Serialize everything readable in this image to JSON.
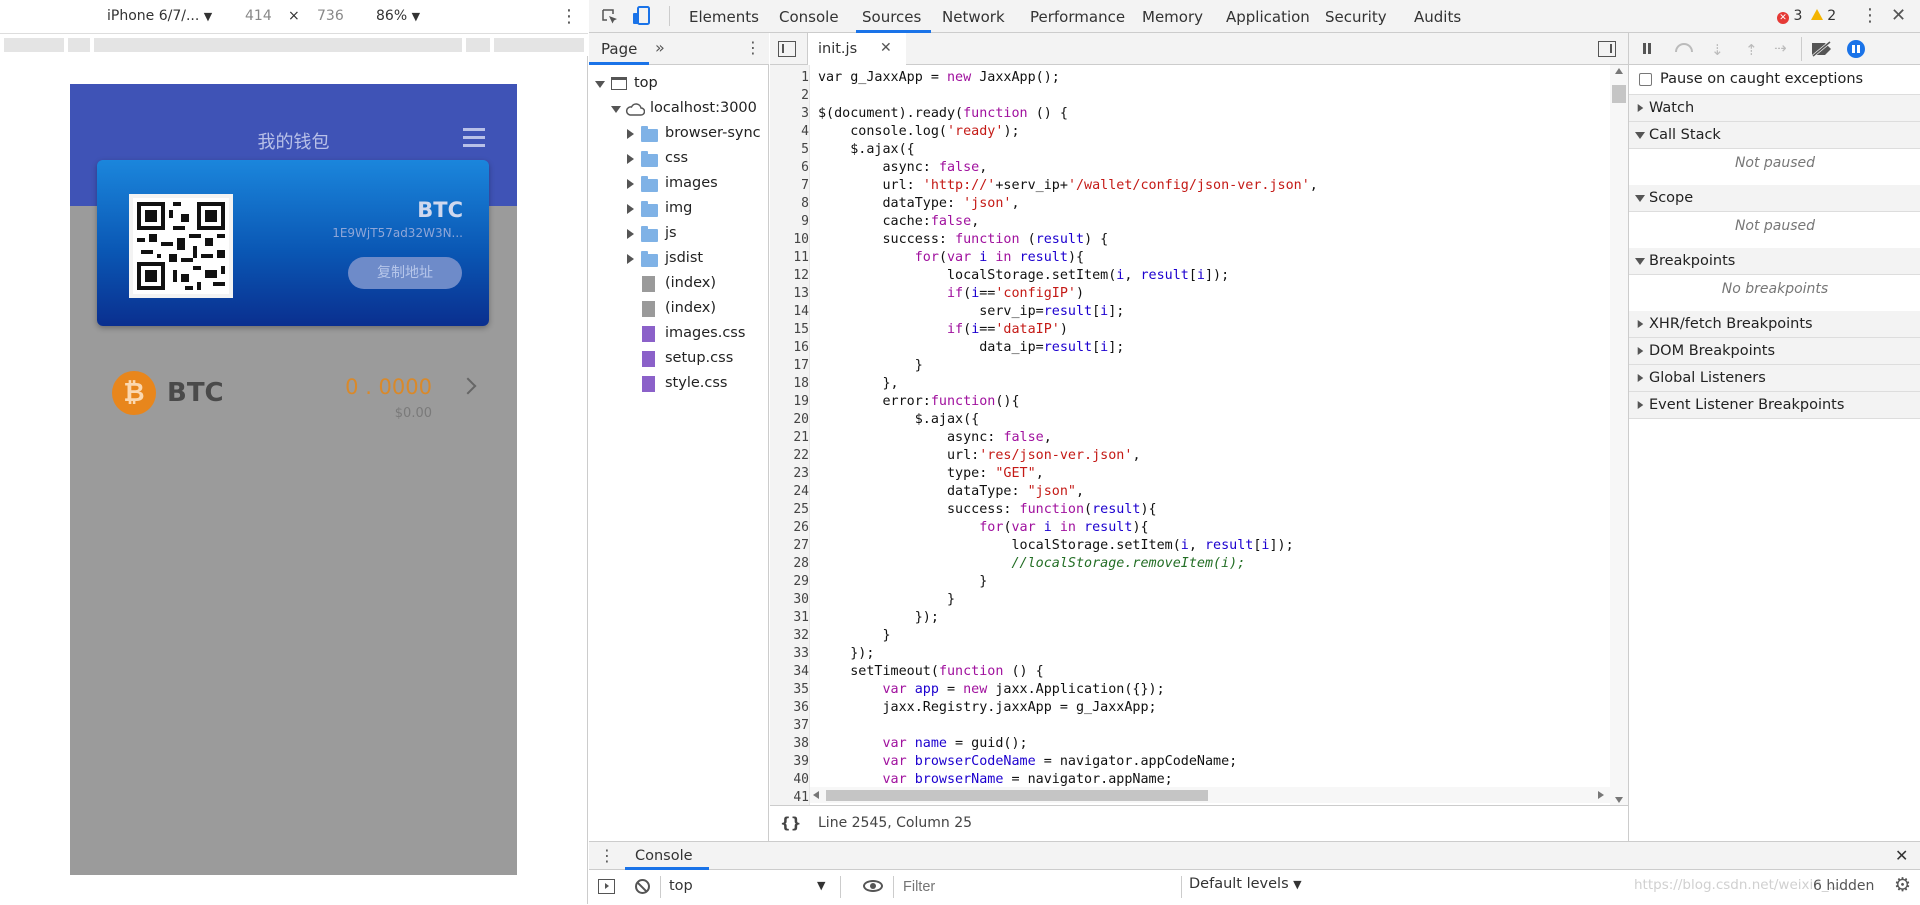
{
  "device_toolbar": {
    "device": "iPhone 6/7/...",
    "width": "414",
    "times": "×",
    "height": "736",
    "zoom": "86%"
  },
  "phone": {
    "title": "我的钱包",
    "card_coin": "BTC",
    "card_address": "1E9WjT57ad32W3N...",
    "copy_button": "复制地址",
    "coin_name": "BTC",
    "coin_amount": "0 . 0000",
    "coin_fiat": "$0.00"
  },
  "devtools": {
    "tabs": [
      "Elements",
      "Console",
      "Sources",
      "Network",
      "Performance",
      "Memory",
      "Application",
      "Security",
      "Audits"
    ],
    "active_tab": "Sources",
    "error_count": "3",
    "warning_count": "2"
  },
  "navigator": {
    "tab": "Page",
    "more": "»",
    "tree": [
      {
        "label": "top",
        "type": "frame"
      },
      {
        "label": "localhost:3000",
        "type": "origin"
      },
      {
        "label": "browser-sync",
        "type": "folder"
      },
      {
        "label": "css",
        "type": "folder"
      },
      {
        "label": "images",
        "type": "folder"
      },
      {
        "label": "img",
        "type": "folder"
      },
      {
        "label": "js",
        "type": "folder"
      },
      {
        "label": "jsdist",
        "type": "folder"
      },
      {
        "label": "(index)",
        "type": "file"
      },
      {
        "label": "(index)",
        "type": "file"
      },
      {
        "label": "images.css",
        "type": "css"
      },
      {
        "label": "setup.css",
        "type": "css"
      },
      {
        "label": "style.css",
        "type": "css"
      }
    ]
  },
  "editor": {
    "file_tab": "init.js",
    "status": "Line 2545, Column 25",
    "lines": [
      [
        [
          "v",
          "var "
        ],
        [
          "v",
          "g_JaxxApp = "
        ],
        [
          "kw",
          "new "
        ],
        [
          "v",
          "JaxxApp();"
        ]
      ],
      [],
      [
        [
          "v",
          "$(document).ready("
        ],
        [
          "kw",
          "function "
        ],
        [
          "v",
          "() {"
        ]
      ],
      [
        [
          "v",
          "    console.log("
        ],
        [
          "str",
          "'ready'"
        ],
        [
          "v",
          ");"
        ]
      ],
      [
        [
          "v",
          "    $.ajax({"
        ]
      ],
      [
        [
          "v",
          "        async: "
        ],
        [
          "kw",
          "false"
        ],
        [
          "v",
          ","
        ]
      ],
      [
        [
          "v",
          "        url: "
        ],
        [
          "str",
          "'http://'"
        ],
        [
          "v",
          "+serv_ip+"
        ],
        [
          "str",
          "'/wallet/config/json-ver.json'"
        ],
        [
          "v",
          ","
        ]
      ],
      [
        [
          "v",
          "        dataType: "
        ],
        [
          "str",
          "'json'"
        ],
        [
          "v",
          ","
        ]
      ],
      [
        [
          "v",
          "        cache:"
        ],
        [
          "kw",
          "false"
        ],
        [
          "v",
          ","
        ]
      ],
      [
        [
          "v",
          "        success: "
        ],
        [
          "kw",
          "function "
        ],
        [
          "v",
          "("
        ],
        [
          "prop",
          "result"
        ],
        [
          "v",
          ") {"
        ]
      ],
      [
        [
          "v",
          "            "
        ],
        [
          "kw",
          "for"
        ],
        [
          "v",
          "("
        ],
        [
          "kw",
          "var "
        ],
        [
          "prop",
          "i "
        ],
        [
          "kw",
          "in "
        ],
        [
          "prop",
          "result"
        ],
        [
          "v",
          "){"
        ]
      ],
      [
        [
          "v",
          "                localStorage.setItem("
        ],
        [
          "prop",
          "i"
        ],
        [
          "v",
          ", "
        ],
        [
          "prop",
          "result"
        ],
        [
          "v",
          "["
        ],
        [
          "prop",
          "i"
        ],
        [
          "v",
          "]);"
        ]
      ],
      [
        [
          "v",
          "                "
        ],
        [
          "kw",
          "if"
        ],
        [
          "v",
          "("
        ],
        [
          "prop",
          "i"
        ],
        [
          "v",
          "=="
        ],
        [
          "str",
          "'configIP'"
        ],
        [
          "v",
          ")"
        ]
      ],
      [
        [
          "v",
          "                    serv_ip="
        ],
        [
          "prop",
          "result"
        ],
        [
          "v",
          "["
        ],
        [
          "prop",
          "i"
        ],
        [
          "v",
          "];"
        ]
      ],
      [
        [
          "v",
          "                "
        ],
        [
          "kw",
          "if"
        ],
        [
          "v",
          "("
        ],
        [
          "prop",
          "i"
        ],
        [
          "v",
          "=="
        ],
        [
          "str",
          "'dataIP'"
        ],
        [
          "v",
          ")"
        ]
      ],
      [
        [
          "v",
          "                    data_ip="
        ],
        [
          "prop",
          "result"
        ],
        [
          "v",
          "["
        ],
        [
          "prop",
          "i"
        ],
        [
          "v",
          "];"
        ]
      ],
      [
        [
          "v",
          "            }"
        ]
      ],
      [
        [
          "v",
          "        },"
        ]
      ],
      [
        [
          "v",
          "        error:"
        ],
        [
          "kw",
          "function"
        ],
        [
          "v",
          "(){"
        ]
      ],
      [
        [
          "v",
          "            $.ajax({"
        ]
      ],
      [
        [
          "v",
          "                async: "
        ],
        [
          "kw",
          "false"
        ],
        [
          "v",
          ","
        ]
      ],
      [
        [
          "v",
          "                url:"
        ],
        [
          "str",
          "'res/json-ver.json'"
        ],
        [
          "v",
          ","
        ]
      ],
      [
        [
          "v",
          "                type: "
        ],
        [
          "str",
          "\"GET\""
        ],
        [
          "v",
          ","
        ]
      ],
      [
        [
          "v",
          "                dataType: "
        ],
        [
          "str",
          "\"json\""
        ],
        [
          "v",
          ","
        ]
      ],
      [
        [
          "v",
          "                success: "
        ],
        [
          "kw",
          "function"
        ],
        [
          "v",
          "("
        ],
        [
          "prop",
          "result"
        ],
        [
          "v",
          "){"
        ]
      ],
      [
        [
          "v",
          "                    "
        ],
        [
          "kw",
          "for"
        ],
        [
          "v",
          "("
        ],
        [
          "kw",
          "var "
        ],
        [
          "prop",
          "i "
        ],
        [
          "kw",
          "in "
        ],
        [
          "prop",
          "result"
        ],
        [
          "v",
          "){"
        ]
      ],
      [
        [
          "v",
          "                        localStorage.setItem("
        ],
        [
          "prop",
          "i"
        ],
        [
          "v",
          ", "
        ],
        [
          "prop",
          "result"
        ],
        [
          "v",
          "["
        ],
        [
          "prop",
          "i"
        ],
        [
          "v",
          "]);"
        ]
      ],
      [
        [
          "cm",
          "                        //localStorage.removeItem(i);"
        ]
      ],
      [
        [
          "v",
          "                    }"
        ]
      ],
      [
        [
          "v",
          "                }"
        ]
      ],
      [
        [
          "v",
          "            });"
        ]
      ],
      [
        [
          "v",
          "        }"
        ]
      ],
      [
        [
          "v",
          "    });"
        ]
      ],
      [
        [
          "v",
          "    setTimeout("
        ],
        [
          "kw",
          "function "
        ],
        [
          "v",
          "() {"
        ]
      ],
      [
        [
          "v",
          "        "
        ],
        [
          "kw",
          "var "
        ],
        [
          "prop",
          "app"
        ],
        [
          "v",
          " = "
        ],
        [
          "kw",
          "new "
        ],
        [
          "v",
          "jaxx.Application({});"
        ]
      ],
      [
        [
          "v",
          "        jaxx.Registry.jaxxApp = g_JaxxApp;"
        ]
      ],
      [],
      [
        [
          "v",
          "        "
        ],
        [
          "kw",
          "var "
        ],
        [
          "prop",
          "name"
        ],
        [
          "v",
          " = guid();"
        ]
      ],
      [
        [
          "v",
          "        "
        ],
        [
          "kw",
          "var "
        ],
        [
          "prop",
          "browserCodeName"
        ],
        [
          "v",
          " = navigator.appCodeName;"
        ]
      ],
      [
        [
          "v",
          "        "
        ],
        [
          "kw",
          "var "
        ],
        [
          "prop",
          "browserName"
        ],
        [
          "v",
          " = navigator.appName;"
        ]
      ],
      []
    ]
  },
  "debugger": {
    "pause_label": "Pause on caught exceptions",
    "sections": [
      {
        "title": "Watch",
        "open": false,
        "note": ""
      },
      {
        "title": "Call Stack",
        "open": true,
        "note": "Not paused"
      },
      {
        "title": "Scope",
        "open": true,
        "note": "Not paused"
      },
      {
        "title": "Breakpoints",
        "open": true,
        "note": "No breakpoints"
      },
      {
        "title": "XHR/fetch Breakpoints",
        "open": false,
        "note": ""
      },
      {
        "title": "DOM Breakpoints",
        "open": false,
        "note": ""
      },
      {
        "title": "Global Listeners",
        "open": false,
        "note": ""
      },
      {
        "title": "Event Listener Breakpoints",
        "open": false,
        "note": ""
      }
    ]
  },
  "drawer": {
    "tab": "Console",
    "context": "top",
    "filter_placeholder": "Filter",
    "levels": "Default levels",
    "hidden": "6 hidden",
    "watermark": "https://blog.csdn.net/weixin_..."
  },
  "colors": {
    "accent": "#1a73e8",
    "phone_header": "#3f53b6",
    "btc_orange": "#f7931a",
    "amount_orange": "#e0902a"
  }
}
